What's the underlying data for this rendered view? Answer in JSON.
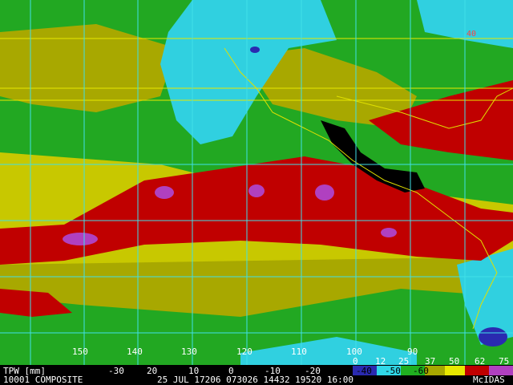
{
  "product": "TPW [mm]",
  "caption": "10001 COMPOSITE",
  "timestamp": "25 JUL 17206 073026 14432 19520 16:00",
  "credit": "McIDAS",
  "latitude_label": "40",
  "longitude_labels": [
    "150",
    "140",
    "130",
    "120",
    "110",
    "100",
    "90"
  ],
  "colorbar_values_top": [
    "20",
    "10",
    "0",
    "-10",
    "-20",
    "0",
    "12",
    "25",
    "37",
    "50",
    "62",
    "75"
  ],
  "colorbar_values_bottom": [
    "-30",
    "-40",
    "-50",
    "-60"
  ],
  "palette": {
    "dry_purple": "#2a2ab0",
    "cyan": "#30d8e8",
    "green": "#20b020",
    "olive": "#a8a800",
    "yellow": "#e8e800",
    "red": "#c00000",
    "magenta": "#b040c0",
    "grid": "#40e0e8",
    "coast": "#e0e000",
    "black": "#000000"
  }
}
